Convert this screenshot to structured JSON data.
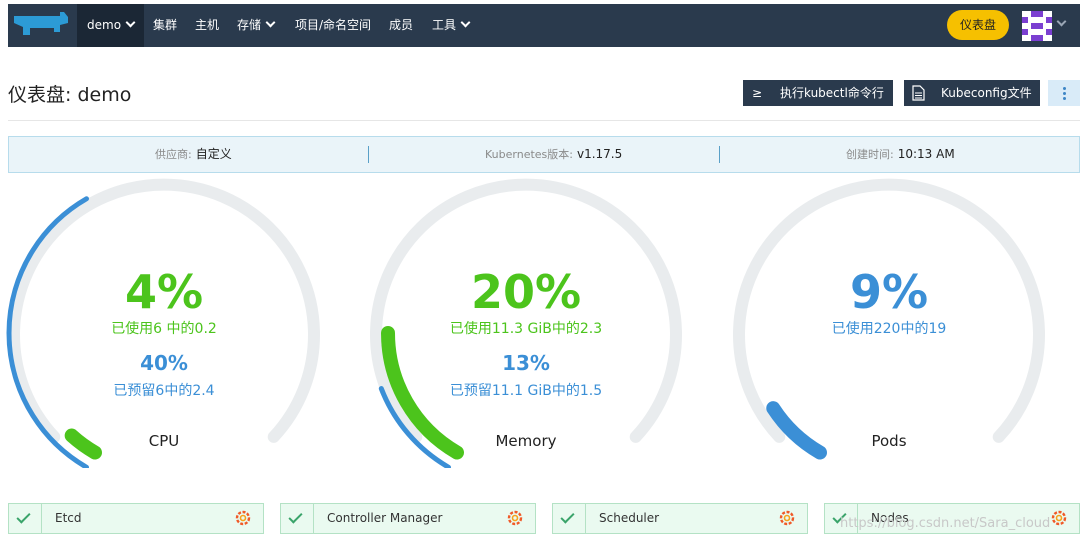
{
  "nav": {
    "cluster": "demo",
    "items": [
      "集群",
      "主机",
      "存储",
      "项目/命名空间",
      "成员",
      "工具"
    ],
    "dashboard_button": "仪表盘"
  },
  "header": {
    "title": "仪表盘: demo",
    "kubectl_button": "执行kubectl命令行",
    "kubectl_icon": "≥",
    "kubeconfig_button": "Kubeconfig文件"
  },
  "info": {
    "provider_label": "供应商:",
    "provider_value": "自定义",
    "k8s_label": "Kubernetes版本:",
    "k8s_value": "v1.17.5",
    "created_label": "创建时间:",
    "created_value": "10:13 AM"
  },
  "gauges": {
    "cpu": {
      "used_percent": "4%",
      "used_text": "已使用6 中的0.2",
      "reserved_percent": "40%",
      "reserved_text": "已预留6中的2.4",
      "label": "CPU",
      "used_fraction": 0.04,
      "reserved_fraction": 0.4
    },
    "memory": {
      "used_percent": "20%",
      "used_text": "已使用11.3 GiB中的2.3",
      "reserved_percent": "13%",
      "reserved_text": "已预留11.1 GiB中的1.5",
      "label": "Memory",
      "used_fraction": 0.2,
      "reserved_fraction": 0.13
    },
    "pods": {
      "used_percent": "9%",
      "used_text": "已使用220中的19",
      "label": "Pods",
      "used_fraction": 0.09
    }
  },
  "components": [
    {
      "label": "Etcd"
    },
    {
      "label": "Controller Manager"
    },
    {
      "label": "Scheduler"
    },
    {
      "label": "Nodes"
    }
  ],
  "watermark": "https://blog.csdn.net/Sara_cloud",
  "colors": {
    "nav_bg": "#2a3a4d",
    "accent_yellow": "#f6c000",
    "green": "#4cc41c",
    "blue": "#3b8fd6",
    "track": "#e9ecee"
  }
}
